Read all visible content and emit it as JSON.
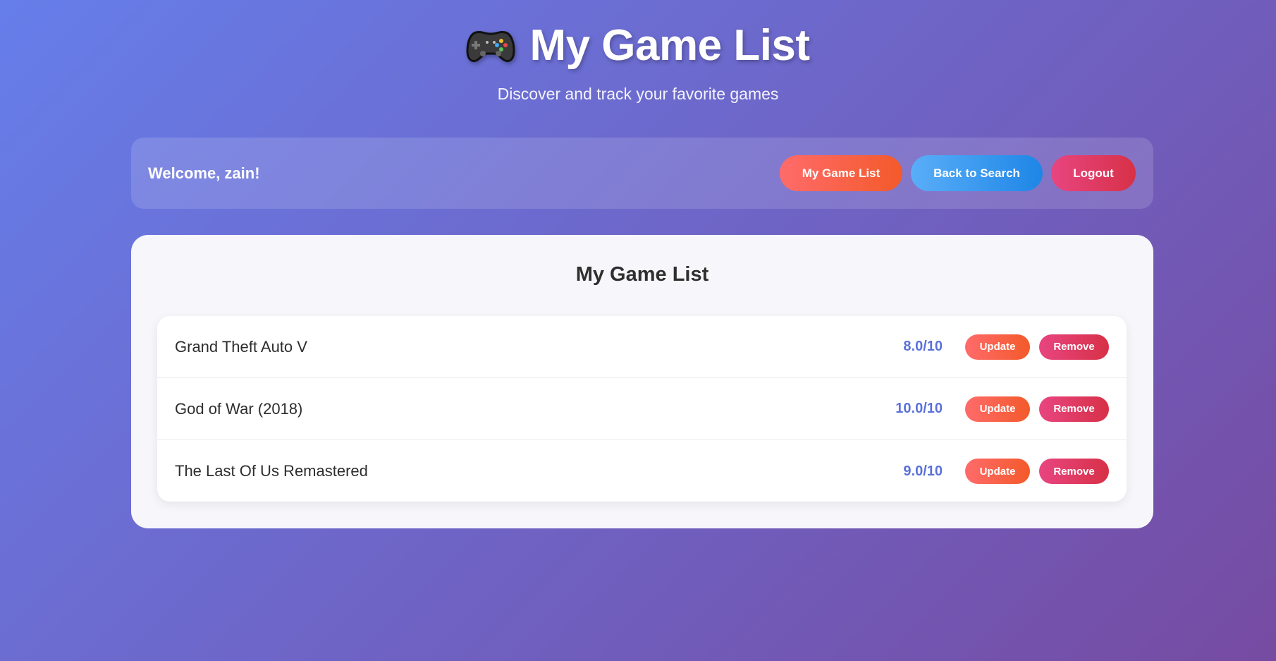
{
  "header": {
    "title": "My Game List",
    "subtitle": "Discover and track your favorite games",
    "icon": "gamepad-icon"
  },
  "nav": {
    "welcome": "Welcome, zain!",
    "my_list_label": "My Game List",
    "back_label": "Back to Search",
    "logout_label": "Logout"
  },
  "list": {
    "title": "My Game List",
    "games": [
      {
        "name": "Grand Theft Auto V",
        "rating": "8.0/10",
        "update_label": "Update",
        "remove_label": "Remove"
      },
      {
        "name": "God of War (2018)",
        "rating": "10.0/10",
        "update_label": "Update",
        "remove_label": "Remove"
      },
      {
        "name": "The Last Of Us Remastered",
        "rating": "9.0/10",
        "update_label": "Update",
        "remove_label": "Remove"
      }
    ]
  },
  "colors": {
    "bg_start": "#667eea",
    "bg_end": "#764ba2",
    "rating": "#5b72d9",
    "orange": "#f35a2a",
    "blue": "#1e86e6",
    "red": "#d73147"
  }
}
